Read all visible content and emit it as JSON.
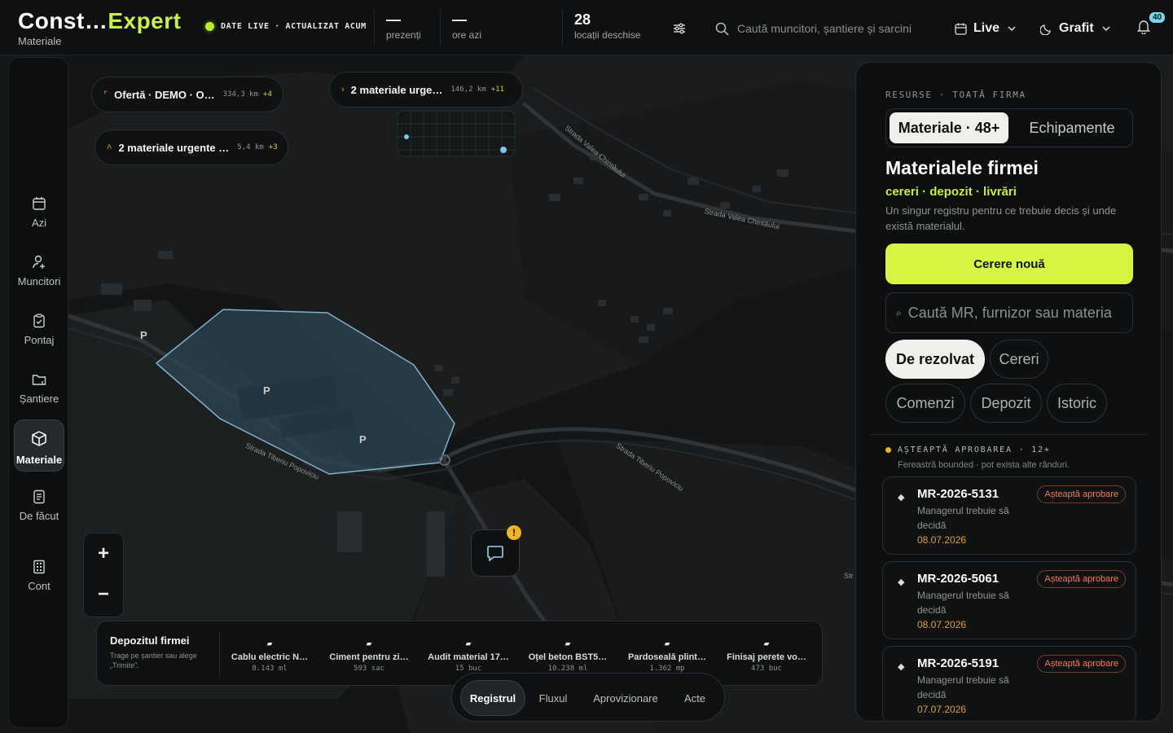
{
  "header": {
    "brand_a": "Const…",
    "brand_b": "Expert",
    "brand_sub": "Materiale",
    "live_status": "DATE LIVE · ACTUALIZAT ACUM",
    "stats": [
      {
        "value": "—",
        "label": "prezenți"
      },
      {
        "value": "—",
        "label": "ore azi"
      },
      {
        "value": "28",
        "label": "locații deschise"
      }
    ],
    "search_placeholder": "Caută muncitori, șantiere și sarcini",
    "mode_label": "Live",
    "theme_label": "Grafit",
    "notifications": "40"
  },
  "sidebar": {
    "items": [
      {
        "label": "Azi",
        "icon": "calendar-icon"
      },
      {
        "label": "Muncitori",
        "icon": "user-add-icon"
      },
      {
        "label": "Pontaj",
        "icon": "clipboard-check-icon"
      },
      {
        "label": "Șantiere",
        "icon": "folder-icon"
      },
      {
        "label": "Materiale",
        "icon": "box-icon",
        "active": true
      },
      {
        "label": "De făcut",
        "icon": "checklist-icon"
      },
      {
        "label": "Cont",
        "icon": "building-icon"
      }
    ]
  },
  "map": {
    "cards": [
      {
        "title": "Ofertă · DEMO · O…",
        "dist": "334,3 km",
        "plus": "+4"
      },
      {
        "title": "2 materiale urge…",
        "dist": "146,2 km",
        "plus": "+11"
      },
      {
        "title": "2 materiale urgente …",
        "dist": "5,4 km",
        "plus": "+3"
      }
    ],
    "street_labels": [
      "Strada Valea Chintăului",
      "Strada Valea Chintăului",
      "Strada Tiberiu Popoviciu",
      "Strada Tiberiu Popoviciu",
      "Str"
    ],
    "parking_label": "P",
    "zoom_in": "+",
    "zoom_out": "−",
    "chat_alert": "!"
  },
  "depot": {
    "title": "Depozitul firmei",
    "subtitle": "Trage pe șantier sau alege „Trimite”.",
    "items": [
      {
        "name": "Cablu electric N…",
        "qty": "8.143 ml"
      },
      {
        "name": "Ciment pentru zi…",
        "qty": "593 sac"
      },
      {
        "name": "Audit material 17…",
        "qty": "15 buc"
      },
      {
        "name": "Oțel beton BST5…",
        "qty": "10.238 ml"
      },
      {
        "name": "Pardoseală plint…",
        "qty": "1.362 mp"
      },
      {
        "name": "Finisaj perete vo…",
        "qty": "473 buc"
      }
    ]
  },
  "bottom_tabs": [
    "Registrul",
    "Fluxul",
    "Aprovizionare",
    "Acte"
  ],
  "panel": {
    "kicker": "RESURSE · TOATĂ FIRMA",
    "seg_active": "Materiale · 48+",
    "seg_other": "Echipamente",
    "title": "Materialele firmei",
    "tagline": "cereri · depozit · livrări",
    "description": "Un singur registru pentru ce trebuie decis și unde există materialul.",
    "cta": "Cerere nouă",
    "search_placeholder": "Caută MR, furnizor sau materia",
    "chips": [
      "De rezolvat",
      "Cereri",
      "Comenzi",
      "Depozit",
      "Istoric"
    ],
    "queue_header": "AȘTEAPTĂ APROBAREA · 12+",
    "queue_note": "Fereastră bounded · pot exista alte rânduri.",
    "requests": [
      {
        "id": "MR-2026-5131",
        "status": "Așteaptă aprobare",
        "desc": "Managerul trebuie să decidă",
        "date": "08.07.2026"
      },
      {
        "id": "MR-2026-5061",
        "status": "Așteaptă aprobare",
        "desc": "Managerul trebuie să decidă",
        "date": "08.07.2026"
      },
      {
        "id": "MR-2026-5191",
        "status": "Așteaptă aprobare",
        "desc": "Managerul trebuie să decidă",
        "date": "07.07.2026"
      }
    ]
  },
  "colors": {
    "accent": "#d5f542",
    "live": "#b8f02c",
    "warning": "#f0b429",
    "status": "#f07c5e"
  }
}
